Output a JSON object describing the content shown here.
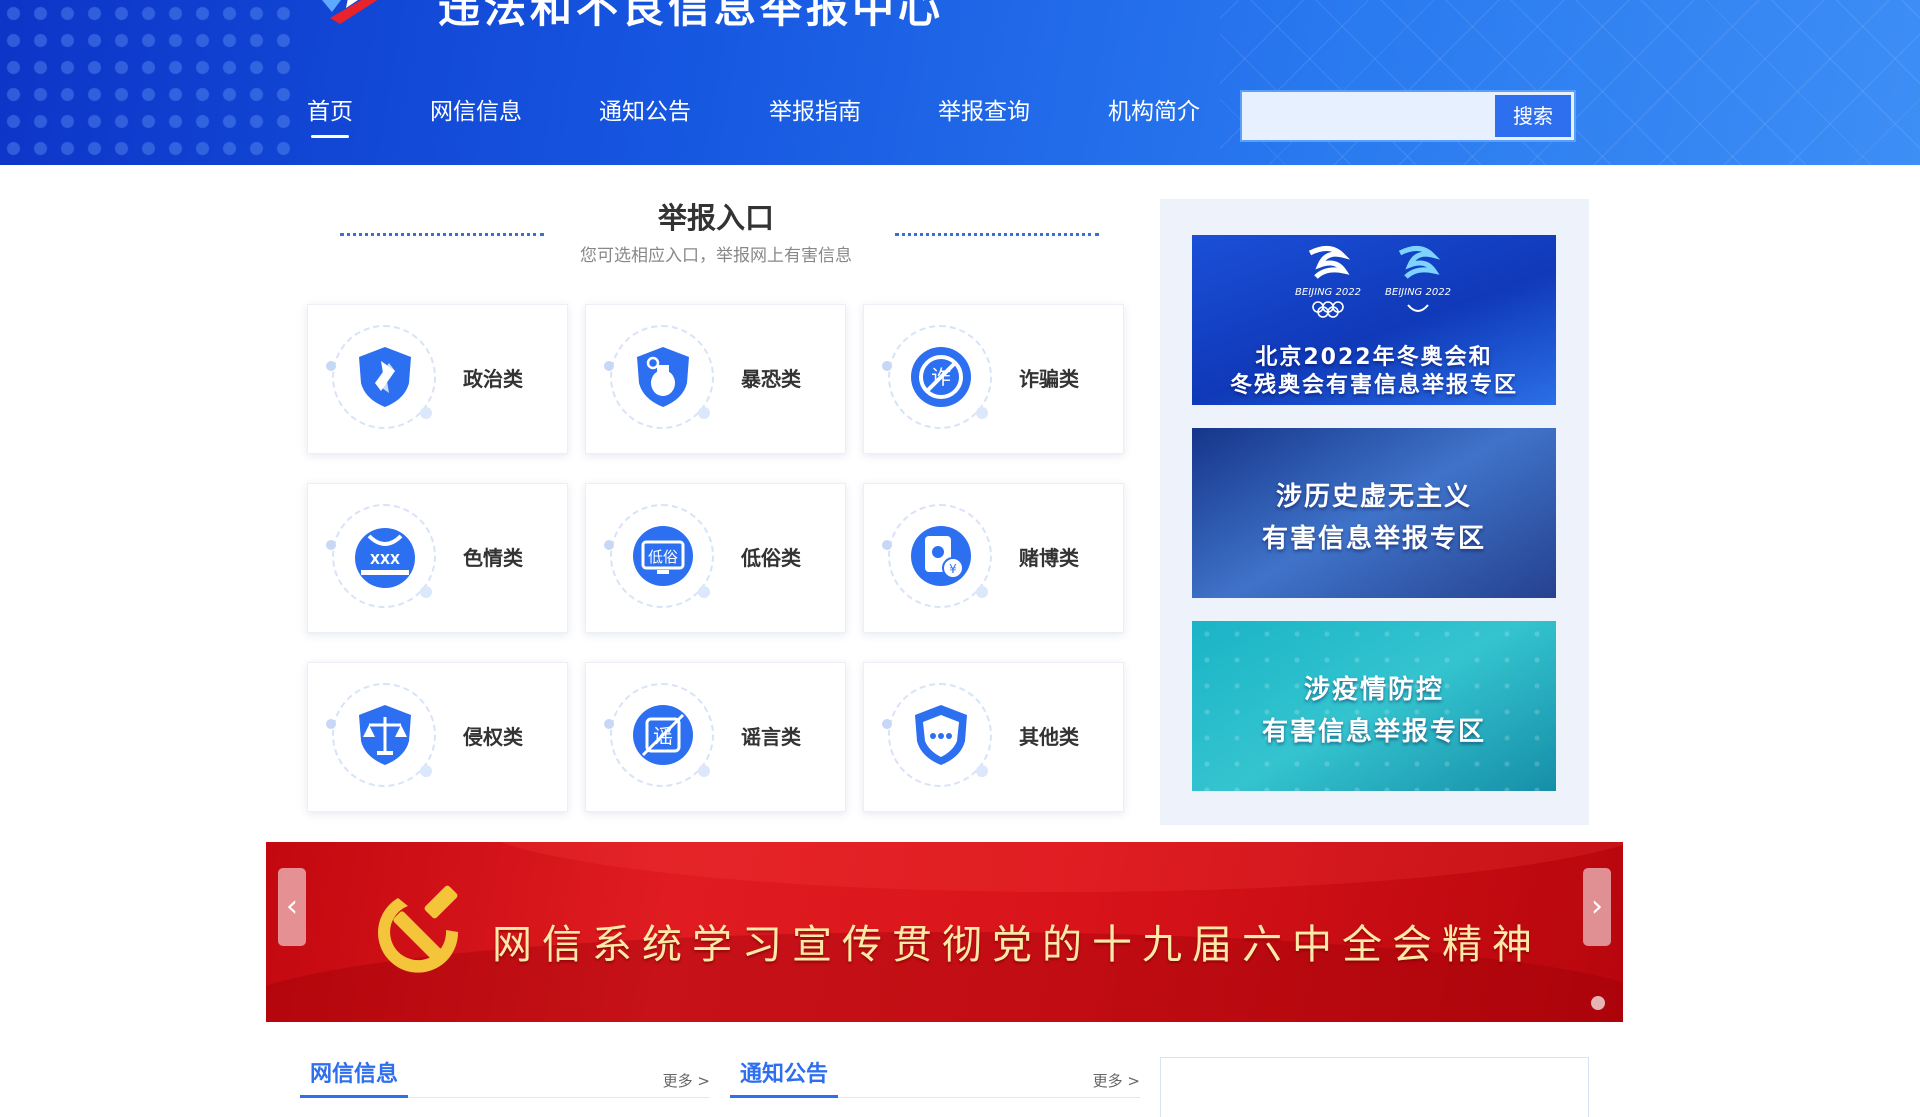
{
  "header": {
    "title": "违法和不良信息举报中心",
    "nav": [
      "首页",
      "网信信息",
      "通知公告",
      "举报指南",
      "举报查询",
      "机构简介"
    ],
    "active_nav": "首页",
    "search": {
      "placeholder": "",
      "button_label": "搜索"
    }
  },
  "report_section": {
    "title": "举报入口",
    "subtitle": "您可选相应入口，举报网上有害信息",
    "categories": [
      {
        "label": "政治类",
        "icon": "political-shield-icon"
      },
      {
        "label": "暴恐类",
        "icon": "grenade-shield-icon"
      },
      {
        "label": "诈骗类",
        "icon": "fraud-icon"
      },
      {
        "label": "色情类",
        "icon": "xxx-icon"
      },
      {
        "label": "低俗类",
        "icon": "vulgar-monitor-icon"
      },
      {
        "label": "赌博类",
        "icon": "gambling-card-icon"
      },
      {
        "label": "侵权类",
        "icon": "scales-shield-icon"
      },
      {
        "label": "谣言类",
        "icon": "rumor-icon"
      },
      {
        "label": "其他类",
        "icon": "chat-shield-icon"
      }
    ]
  },
  "side_banners": [
    {
      "lines": [
        "北京2022年冬奥会和",
        "冬残奥会有害信息举报专区"
      ],
      "logo_text": [
        "BEIJING 2022",
        "BEIJING 2022"
      ]
    },
    {
      "lines": [
        "涉历史虚无主义",
        "有害信息举报专区"
      ]
    },
    {
      "lines": [
        "涉疫情防控",
        "有害信息举报专区"
      ]
    }
  ],
  "carousel": {
    "slogan": "网信系统学习宣传贯彻党的十九届六中全会精神",
    "prev": "‹",
    "next": "›"
  },
  "lists": [
    {
      "title": "网信信息",
      "more": "更多 >"
    },
    {
      "title": "通知公告",
      "more": "更多 >"
    }
  ],
  "colors": {
    "header_blue": "#1656e0",
    "accent_blue": "#2e6ff0",
    "banner_red": "#d8131a",
    "slogan_gold": "#ffe9a8"
  }
}
